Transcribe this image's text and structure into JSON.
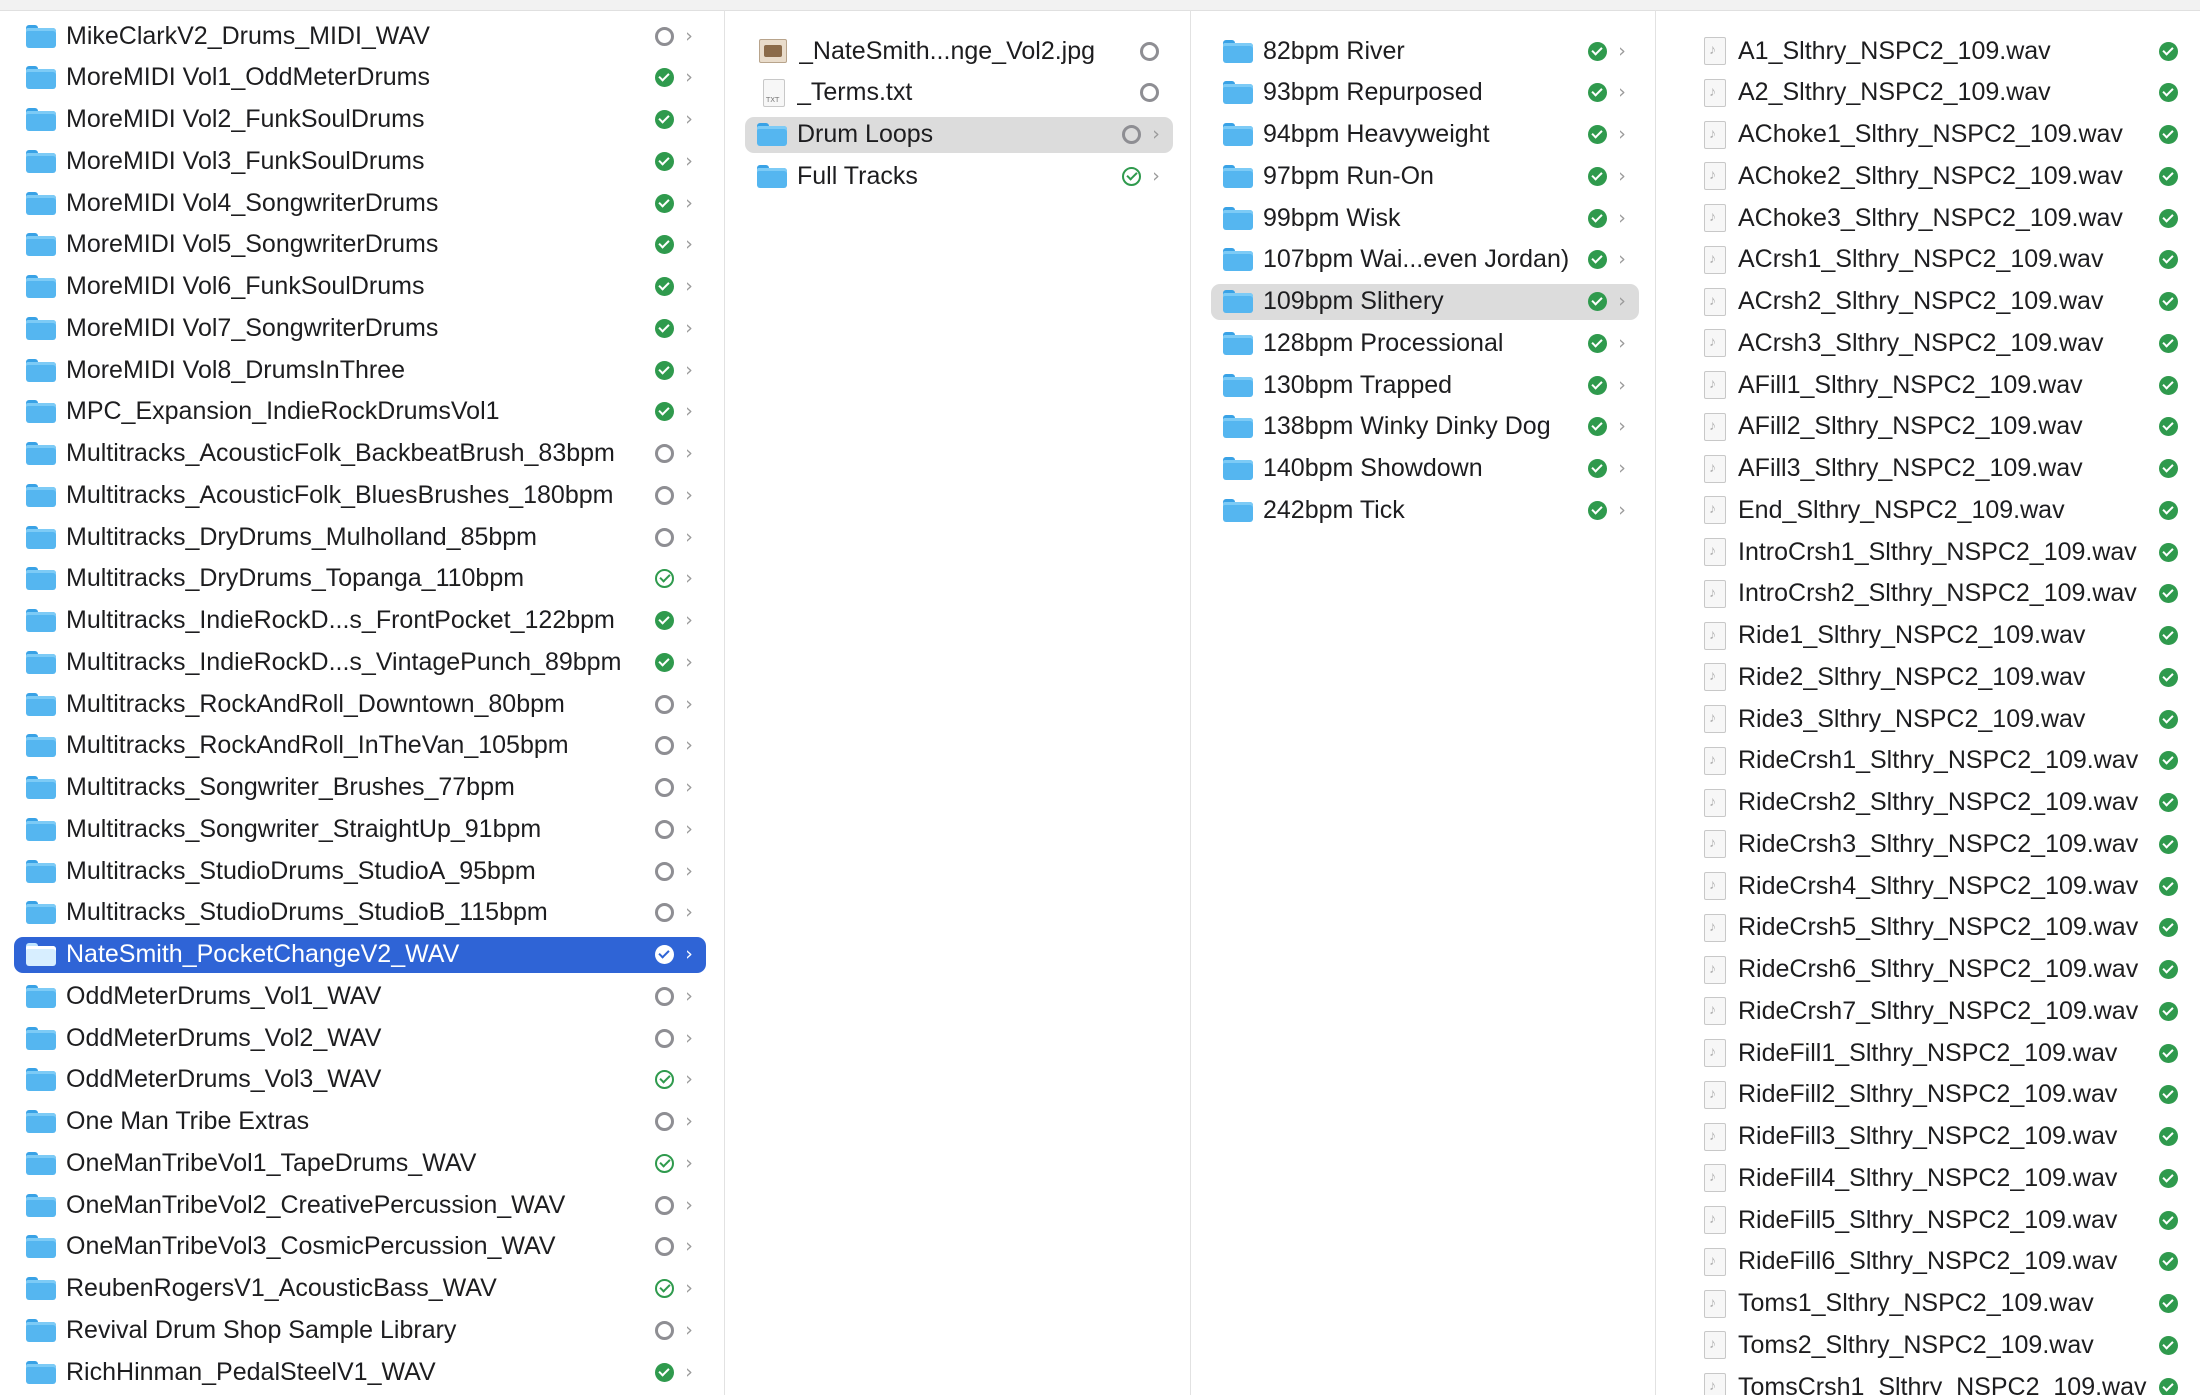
{
  "columns": [
    {
      "items": [
        {
          "name": "MikeClarkV2_Drums_MIDI_WAV",
          "kind": "folder",
          "status": "cloud",
          "chevron": true
        },
        {
          "name": "MoreMIDI Vol1_OddMeterDrums",
          "kind": "folder",
          "status": "synced",
          "chevron": true
        },
        {
          "name": "MoreMIDI Vol2_FunkSoulDrums",
          "kind": "folder",
          "status": "synced",
          "chevron": true
        },
        {
          "name": "MoreMIDI Vol3_FunkSoulDrums",
          "kind": "folder",
          "status": "synced",
          "chevron": true
        },
        {
          "name": "MoreMIDI Vol4_SongwriterDrums",
          "kind": "folder",
          "status": "synced",
          "chevron": true
        },
        {
          "name": "MoreMIDI Vol5_SongwriterDrums",
          "kind": "folder",
          "status": "synced",
          "chevron": true
        },
        {
          "name": "MoreMIDI Vol6_FunkSoulDrums",
          "kind": "folder",
          "status": "synced",
          "chevron": true
        },
        {
          "name": "MoreMIDI Vol7_SongwriterDrums",
          "kind": "folder",
          "status": "synced",
          "chevron": true
        },
        {
          "name": "MoreMIDI Vol8_DrumsInThree",
          "kind": "folder",
          "status": "synced",
          "chevron": true
        },
        {
          "name": "MPC_Expansion_IndieRockDrumsVol1",
          "kind": "folder",
          "status": "synced",
          "chevron": true
        },
        {
          "name": "Multitracks_AcousticFolk_BackbeatBrush_83bpm",
          "kind": "folder",
          "status": "cloud",
          "chevron": true
        },
        {
          "name": "Multitracks_AcousticFolk_BluesBrushes_180bpm",
          "kind": "folder",
          "status": "cloud",
          "chevron": true
        },
        {
          "name": "Multitracks_DryDrums_Mulholland_85bpm",
          "kind": "folder",
          "status": "cloud",
          "chevron": true
        },
        {
          "name": "Multitracks_DryDrums_Topanga_110bpm",
          "kind": "folder",
          "status": "outline",
          "chevron": true
        },
        {
          "name": "Multitracks_IndieRockD...s_FrontPocket_122bpm",
          "kind": "folder",
          "status": "synced",
          "chevron": true
        },
        {
          "name": "Multitracks_IndieRockD...s_VintagePunch_89bpm",
          "kind": "folder",
          "status": "synced",
          "chevron": true
        },
        {
          "name": "Multitracks_RockAndRoll_Downtown_80bpm",
          "kind": "folder",
          "status": "cloud",
          "chevron": true
        },
        {
          "name": "Multitracks_RockAndRoll_InTheVan_105bpm",
          "kind": "folder",
          "status": "cloud",
          "chevron": true
        },
        {
          "name": "Multitracks_Songwriter_Brushes_77bpm",
          "kind": "folder",
          "status": "cloud",
          "chevron": true
        },
        {
          "name": "Multitracks_Songwriter_StraightUp_91bpm",
          "kind": "folder",
          "status": "cloud",
          "chevron": true
        },
        {
          "name": "Multitracks_StudioDrums_StudioA_95bpm",
          "kind": "folder",
          "status": "cloud",
          "chevron": true
        },
        {
          "name": "Multitracks_StudioDrums_StudioB_115bpm",
          "kind": "folder",
          "status": "cloud",
          "chevron": true
        },
        {
          "name": "NateSmith_PocketChangeV2_WAV",
          "kind": "folder",
          "status": "synced",
          "chevron": true,
          "selected": "blue"
        },
        {
          "name": "OddMeterDrums_Vol1_WAV",
          "kind": "folder",
          "status": "cloud",
          "chevron": true
        },
        {
          "name": "OddMeterDrums_Vol2_WAV",
          "kind": "folder",
          "status": "cloud",
          "chevron": true
        },
        {
          "name": "OddMeterDrums_Vol3_WAV",
          "kind": "folder",
          "status": "outline",
          "chevron": true
        },
        {
          "name": "One Man Tribe Extras",
          "kind": "folder",
          "status": "cloud",
          "chevron": true
        },
        {
          "name": "OneManTribeVol1_TapeDrums_WAV",
          "kind": "folder",
          "status": "outline",
          "chevron": true
        },
        {
          "name": "OneManTribeVol2_CreativePercussion_WAV",
          "kind": "folder",
          "status": "cloud",
          "chevron": true
        },
        {
          "name": "OneManTribeVol3_CosmicPercussion_WAV",
          "kind": "folder",
          "status": "cloud",
          "chevron": true
        },
        {
          "name": "ReubenRogersV1_AcousticBass_WAV",
          "kind": "folder",
          "status": "outline",
          "chevron": true
        },
        {
          "name": "Revival Drum Shop Sample Library",
          "kind": "folder",
          "status": "cloud",
          "chevron": true
        },
        {
          "name": "RichHinman_PedalSteelV1_WAV",
          "kind": "folder",
          "status": "synced",
          "chevron": true
        }
      ]
    },
    {
      "items": [
        {
          "name": "_NateSmith...nge_Vol2.jpg",
          "kind": "image",
          "status": "cloud",
          "chevron": false
        },
        {
          "name": "_Terms.txt",
          "kind": "text",
          "status": "cloud",
          "chevron": false
        },
        {
          "name": "Drum Loops",
          "kind": "folder",
          "status": "cloud",
          "chevron": true,
          "selected": "gray"
        },
        {
          "name": "Full Tracks",
          "kind": "folder",
          "status": "outline",
          "chevron": true
        }
      ]
    },
    {
      "items": [
        {
          "name": "82bpm River",
          "kind": "folder",
          "status": "synced",
          "chevron": true
        },
        {
          "name": "93bpm Repurposed",
          "kind": "folder",
          "status": "synced",
          "chevron": true
        },
        {
          "name": "94bpm Heavyweight",
          "kind": "folder",
          "status": "synced",
          "chevron": true
        },
        {
          "name": "97bpm Run-On",
          "kind": "folder",
          "status": "synced",
          "chevron": true
        },
        {
          "name": "99bpm Wisk",
          "kind": "folder",
          "status": "synced",
          "chevron": true
        },
        {
          "name": "107bpm Wai...even Jordan)",
          "kind": "folder",
          "status": "synced",
          "chevron": true
        },
        {
          "name": "109bpm Slithery",
          "kind": "folder",
          "status": "synced",
          "chevron": true,
          "selected": "gray"
        },
        {
          "name": "128bpm Processional",
          "kind": "folder",
          "status": "synced",
          "chevron": true
        },
        {
          "name": "130bpm Trapped",
          "kind": "folder",
          "status": "synced",
          "chevron": true
        },
        {
          "name": "138bpm Winky Dinky Dog",
          "kind": "folder",
          "status": "synced",
          "chevron": true
        },
        {
          "name": "140bpm Showdown",
          "kind": "folder",
          "status": "synced",
          "chevron": true
        },
        {
          "name": "242bpm Tick",
          "kind": "folder",
          "status": "synced",
          "chevron": true
        }
      ]
    },
    {
      "items": [
        {
          "name": "A1_Slthry_NSPC2_109.wav",
          "kind": "audio",
          "status": "synced",
          "chevron": false
        },
        {
          "name": "A2_Slthry_NSPC2_109.wav",
          "kind": "audio",
          "status": "synced",
          "chevron": false
        },
        {
          "name": "AChoke1_Slthry_NSPC2_109.wav",
          "kind": "audio",
          "status": "synced",
          "chevron": false
        },
        {
          "name": "AChoke2_Slthry_NSPC2_109.wav",
          "kind": "audio",
          "status": "synced",
          "chevron": false
        },
        {
          "name": "AChoke3_Slthry_NSPC2_109.wav",
          "kind": "audio",
          "status": "synced",
          "chevron": false
        },
        {
          "name": "ACrsh1_Slthry_NSPC2_109.wav",
          "kind": "audio",
          "status": "synced",
          "chevron": false
        },
        {
          "name": "ACrsh2_Slthry_NSPC2_109.wav",
          "kind": "audio",
          "status": "synced",
          "chevron": false
        },
        {
          "name": "ACrsh3_Slthry_NSPC2_109.wav",
          "kind": "audio",
          "status": "synced",
          "chevron": false
        },
        {
          "name": "AFill1_Slthry_NSPC2_109.wav",
          "kind": "audio",
          "status": "synced",
          "chevron": false
        },
        {
          "name": "AFill2_Slthry_NSPC2_109.wav",
          "kind": "audio",
          "status": "synced",
          "chevron": false
        },
        {
          "name": "AFill3_Slthry_NSPC2_109.wav",
          "kind": "audio",
          "status": "synced",
          "chevron": false
        },
        {
          "name": "End_Slthry_NSPC2_109.wav",
          "kind": "audio",
          "status": "synced",
          "chevron": false
        },
        {
          "name": "IntroCrsh1_Slthry_NSPC2_109.wav",
          "kind": "audio",
          "status": "synced",
          "chevron": false
        },
        {
          "name": "IntroCrsh2_Slthry_NSPC2_109.wav",
          "kind": "audio",
          "status": "synced",
          "chevron": false
        },
        {
          "name": "Ride1_Slthry_NSPC2_109.wav",
          "kind": "audio",
          "status": "synced",
          "chevron": false
        },
        {
          "name": "Ride2_Slthry_NSPC2_109.wav",
          "kind": "audio",
          "status": "synced",
          "chevron": false
        },
        {
          "name": "Ride3_Slthry_NSPC2_109.wav",
          "kind": "audio",
          "status": "synced",
          "chevron": false
        },
        {
          "name": "RideCrsh1_Slthry_NSPC2_109.wav",
          "kind": "audio",
          "status": "synced",
          "chevron": false
        },
        {
          "name": "RideCrsh2_Slthry_NSPC2_109.wav",
          "kind": "audio",
          "status": "synced",
          "chevron": false
        },
        {
          "name": "RideCrsh3_Slthry_NSPC2_109.wav",
          "kind": "audio",
          "status": "synced",
          "chevron": false
        },
        {
          "name": "RideCrsh4_Slthry_NSPC2_109.wav",
          "kind": "audio",
          "status": "synced",
          "chevron": false
        },
        {
          "name": "RideCrsh5_Slthry_NSPC2_109.wav",
          "kind": "audio",
          "status": "synced",
          "chevron": false
        },
        {
          "name": "RideCrsh6_Slthry_NSPC2_109.wav",
          "kind": "audio",
          "status": "synced",
          "chevron": false
        },
        {
          "name": "RideCrsh7_Slthry_NSPC2_109.wav",
          "kind": "audio",
          "status": "synced",
          "chevron": false
        },
        {
          "name": "RideFill1_Slthry_NSPC2_109.wav",
          "kind": "audio",
          "status": "synced",
          "chevron": false
        },
        {
          "name": "RideFill2_Slthry_NSPC2_109.wav",
          "kind": "audio",
          "status": "synced",
          "chevron": false
        },
        {
          "name": "RideFill3_Slthry_NSPC2_109.wav",
          "kind": "audio",
          "status": "synced",
          "chevron": false
        },
        {
          "name": "RideFill4_Slthry_NSPC2_109.wav",
          "kind": "audio",
          "status": "synced",
          "chevron": false
        },
        {
          "name": "RideFill5_Slthry_NSPC2_109.wav",
          "kind": "audio",
          "status": "synced",
          "chevron": false
        },
        {
          "name": "RideFill6_Slthry_NSPC2_109.wav",
          "kind": "audio",
          "status": "synced",
          "chevron": false
        },
        {
          "name": "Toms1_Slthry_NSPC2_109.wav",
          "kind": "audio",
          "status": "synced",
          "chevron": false
        },
        {
          "name": "Toms2_Slthry_NSPC2_109.wav",
          "kind": "audio",
          "status": "synced",
          "chevron": false
        },
        {
          "name": "TomsCrsh1_Slthry_NSPC2_109.wav",
          "kind": "audio",
          "status": "synced",
          "chevron": false
        }
      ]
    }
  ],
  "colors": {
    "selection_blue": "#2f64d6",
    "selection_gray": "#dcdcdc",
    "synced_green": "#2f9a4d",
    "cloud_gray": "#8e8e93",
    "folder_blue": "#55b6f0"
  },
  "icons": {
    "folder": "folder-icon",
    "audio": "audio-file-icon",
    "text": "text-file-icon",
    "image": "image-file-icon",
    "synced": "synced-check-icon",
    "outline": "sync-check-outline-icon",
    "cloud": "cloud-status-icon",
    "chevron": "chevron-right-icon"
  }
}
